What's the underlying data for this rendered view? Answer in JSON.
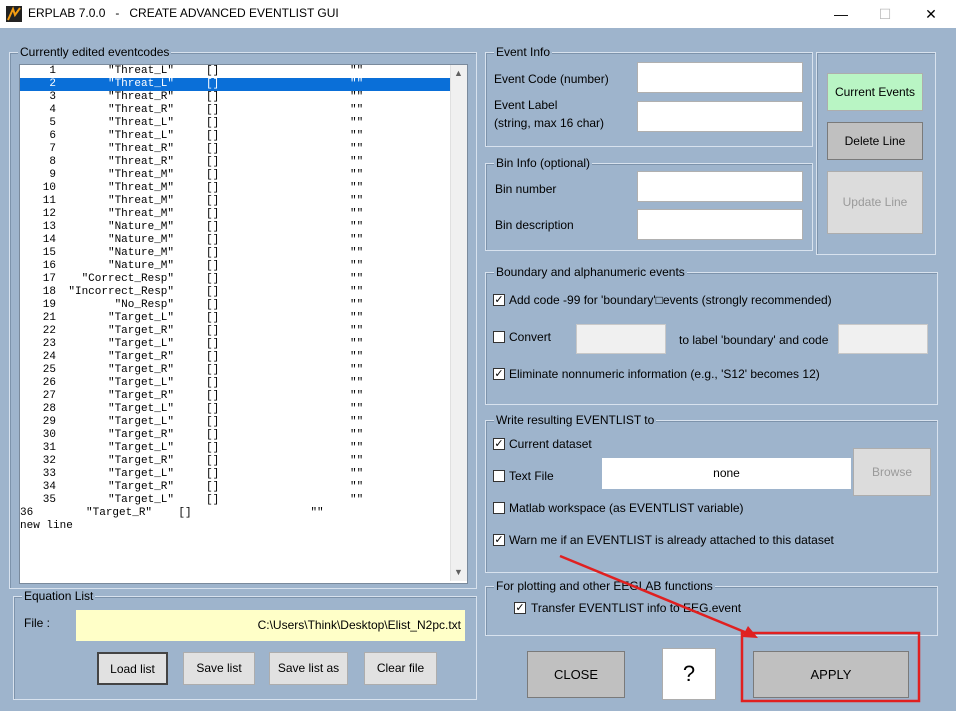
{
  "window": {
    "title": "ERPLAB 7.0.0   -   CREATE ADVANCED EVENTLIST GUI",
    "controls": {
      "minimize": "—",
      "maximize": "☐",
      "close": "✕"
    }
  },
  "eventcodes_panel": {
    "title": "Currently edited eventcodes",
    "rows": [
      {
        "idx": "1",
        "code": "\"Threat_L\"",
        "bin": "[]",
        "desc": "\"\""
      },
      {
        "idx": "2",
        "code": "\"Threat_L\"",
        "bin": "[]",
        "desc": "\"\"",
        "selected": true
      },
      {
        "idx": "3",
        "code": "\"Threat_R\"",
        "bin": "[]",
        "desc": "\"\""
      },
      {
        "idx": "4",
        "code": "\"Threat_R\"",
        "bin": "[]",
        "desc": "\"\""
      },
      {
        "idx": "5",
        "code": "\"Threat_L\"",
        "bin": "[]",
        "desc": "\"\""
      },
      {
        "idx": "6",
        "code": "\"Threat_L\"",
        "bin": "[]",
        "desc": "\"\""
      },
      {
        "idx": "7",
        "code": "\"Threat_R\"",
        "bin": "[]",
        "desc": "\"\""
      },
      {
        "idx": "8",
        "code": "\"Threat_R\"",
        "bin": "[]",
        "desc": "\"\""
      },
      {
        "idx": "9",
        "code": "\"Threat_M\"",
        "bin": "[]",
        "desc": "\"\""
      },
      {
        "idx": "10",
        "code": "\"Threat_M\"",
        "bin": "[]",
        "desc": "\"\""
      },
      {
        "idx": "11",
        "code": "\"Threat_M\"",
        "bin": "[]",
        "desc": "\"\""
      },
      {
        "idx": "12",
        "code": "\"Threat_M\"",
        "bin": "[]",
        "desc": "\"\""
      },
      {
        "idx": "13",
        "code": "\"Nature_M\"",
        "bin": "[]",
        "desc": "\"\""
      },
      {
        "idx": "14",
        "code": "\"Nature_M\"",
        "bin": "[]",
        "desc": "\"\""
      },
      {
        "idx": "15",
        "code": "\"Nature_M\"",
        "bin": "[]",
        "desc": "\"\""
      },
      {
        "idx": "16",
        "code": "\"Nature_M\"",
        "bin": "[]",
        "desc": "\"\""
      },
      {
        "idx": "17",
        "code": "\"Correct_Resp\"",
        "bin": "[]",
        "desc": "\"\""
      },
      {
        "idx": "18",
        "code": "\"Incorrect_Resp\"",
        "bin": "[]",
        "desc": "\"\""
      },
      {
        "idx": "19",
        "code": "\"No_Resp\"",
        "bin": "[]",
        "desc": "\"\""
      },
      {
        "idx": "21",
        "code": "\"Target_L\"",
        "bin": "[]",
        "desc": "\"\""
      },
      {
        "idx": "22",
        "code": "\"Target_R\"",
        "bin": "[]",
        "desc": "\"\""
      },
      {
        "idx": "23",
        "code": "\"Target_L\"",
        "bin": "[]",
        "desc": "\"\""
      },
      {
        "idx": "24",
        "code": "\"Target_R\"",
        "bin": "[]",
        "desc": "\"\""
      },
      {
        "idx": "25",
        "code": "\"Target_R\"",
        "bin": "[]",
        "desc": "\"\""
      },
      {
        "idx": "26",
        "code": "\"Target_L\"",
        "bin": "[]",
        "desc": "\"\""
      },
      {
        "idx": "27",
        "code": "\"Target_R\"",
        "bin": "[]",
        "desc": "\"\""
      },
      {
        "idx": "28",
        "code": "\"Target_L\"",
        "bin": "[]",
        "desc": "\"\""
      },
      {
        "idx": "29",
        "code": "\"Target_L\"",
        "bin": "[]",
        "desc": "\"\""
      },
      {
        "idx": "30",
        "code": "\"Target_R\"",
        "bin": "[]",
        "desc": "\"\""
      },
      {
        "idx": "31",
        "code": "\"Target_L\"",
        "bin": "[]",
        "desc": "\"\""
      },
      {
        "idx": "32",
        "code": "\"Target_R\"",
        "bin": "[]",
        "desc": "\"\""
      },
      {
        "idx": "33",
        "code": "\"Target_L\"",
        "bin": "[]",
        "desc": "\"\""
      },
      {
        "idx": "34",
        "code": "\"Target_R\"",
        "bin": "[]",
        "desc": "\"\""
      },
      {
        "idx": "35",
        "code": "\"Target_L\"",
        "bin": "[]",
        "desc": "\"\""
      }
    ],
    "extra_line": "36        \"Target_R\"    []                  \"\"",
    "new_line": "new line"
  },
  "equation_list": {
    "title": "Equation List",
    "file_label": "File :",
    "file_value": "C:\\Users\\Think\\Desktop\\Elist_N2pc.txt",
    "buttons": {
      "load": "Load list",
      "save": "Save list",
      "save_as": "Save list as",
      "clear": "Clear file"
    }
  },
  "event_info": {
    "title": "Event Info",
    "code_label": "Event Code (number)",
    "label_label_1": "Event Label",
    "label_label_2": "(string, max 16 char)"
  },
  "bin_info": {
    "title": "Bin Info (optional)",
    "number_label": "Bin number",
    "desc_label": "Bin description"
  },
  "side_buttons": {
    "current": "Current Events",
    "delete": "Delete Line",
    "update": "Update Line"
  },
  "boundary": {
    "title": "Boundary and alphanumeric events",
    "add_code": "Add code -99 for 'boundary'□events (strongly recommended)",
    "convert": "Convert",
    "to_label": "to label 'boundary' and code",
    "eliminate": "Eliminate nonnumeric information (e.g., 'S12' becomes 12)"
  },
  "write": {
    "title": "Write resulting EVENTLIST to",
    "current_dataset": "Current dataset",
    "text_file": "Text File",
    "text_file_value": "none",
    "browse": "Browse",
    "workspace": "Matlab workspace (as EVENTLIST variable)",
    "warn": "Warn me if an EVENTLIST is already attached to this dataset"
  },
  "plotting": {
    "title": "For plotting and other EEGLAB functions",
    "transfer": "Transfer EVENTLIST info to EEG.event"
  },
  "bottom_buttons": {
    "close": "CLOSE",
    "help": "?",
    "apply": "APPLY"
  },
  "colors": {
    "background": "#9eb4cc",
    "selection": "#0a6fd8",
    "current_events": "#b9f5c4",
    "annotation": "#e02020",
    "file_field": "#ffffc8"
  }
}
